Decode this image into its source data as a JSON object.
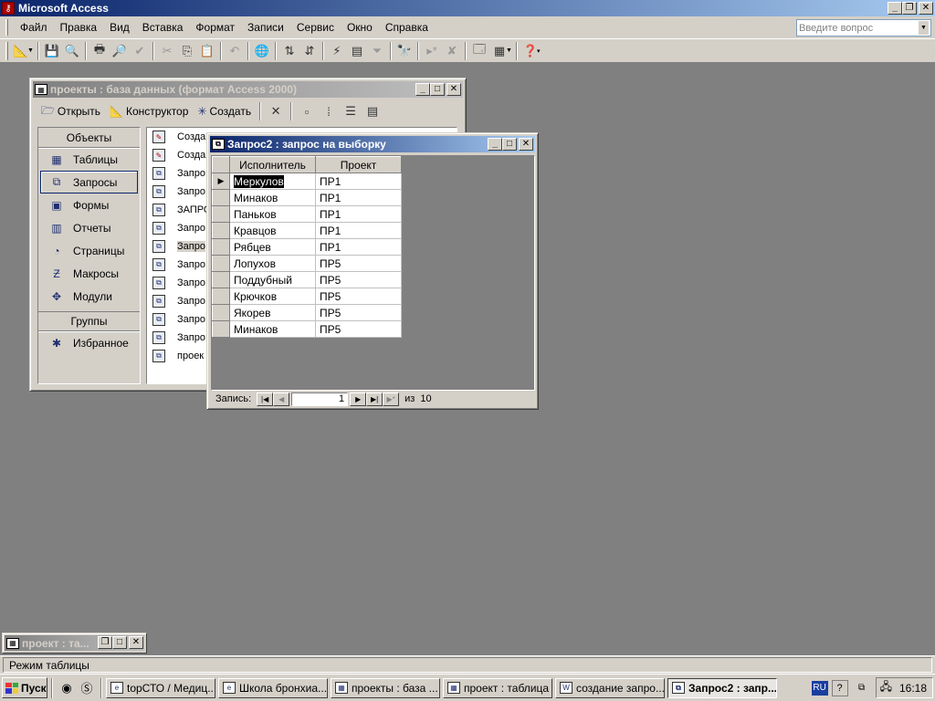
{
  "app": {
    "title": "Microsoft Access"
  },
  "menu": [
    "Файл",
    "Правка",
    "Вид",
    "Вставка",
    "Формат",
    "Записи",
    "Сервис",
    "Окно",
    "Справка"
  ],
  "help_box": {
    "placeholder": "Введите вопрос"
  },
  "db_window": {
    "title": "проекты : база данных (формат Access 2000)",
    "toolbar": {
      "open": "Открыть",
      "design": "Конструктор",
      "create": "Создать"
    },
    "objects_header": "Объекты",
    "objects": [
      {
        "label": "Таблицы",
        "icon": "table-icon"
      },
      {
        "label": "Запросы",
        "icon": "query-icon"
      },
      {
        "label": "Формы",
        "icon": "form-icon"
      },
      {
        "label": "Отчеты",
        "icon": "report-icon"
      },
      {
        "label": "Страницы",
        "icon": "page-icon"
      },
      {
        "label": "Макросы",
        "icon": "macro-icon"
      },
      {
        "label": "Модули",
        "icon": "module-icon"
      }
    ],
    "groups_header": "Группы",
    "groups": [
      {
        "label": "Избранное",
        "icon": "favorites-icon"
      }
    ],
    "items": [
      "Созда",
      "Созда",
      "Запро",
      "Запро",
      "ЗАПРО",
      "Запро",
      "Запро",
      "Запро",
      "Запро",
      "Запро",
      "Запро",
      "Запро",
      "проек"
    ]
  },
  "query_window": {
    "title": "Запрос2 : запрос на выборку",
    "columns": [
      "Исполнитель",
      "Проект"
    ],
    "rows": [
      [
        "Меркулов",
        "ПР1"
      ],
      [
        "Минаков",
        "ПР1"
      ],
      [
        "Паньков",
        "ПР1"
      ],
      [
        "Кравцов",
        "ПР1"
      ],
      [
        "Рябцев",
        "ПР1"
      ],
      [
        "Лопухов",
        "ПР5"
      ],
      [
        "Поддубный",
        "ПР5"
      ],
      [
        "Крючков",
        "ПР5"
      ],
      [
        "Якорев",
        "ПР5"
      ],
      [
        "Минаков",
        "ПР5"
      ]
    ],
    "nav": {
      "label": "Запись:",
      "current": "1",
      "of_label": "из",
      "total": "10"
    }
  },
  "minimized_window": {
    "title": "проект : та..."
  },
  "status": {
    "text": "Режим таблицы"
  },
  "taskbar": {
    "start": "Пуск",
    "tasks": [
      {
        "label": "topСТО / Медиц...",
        "active": false
      },
      {
        "label": "Школа бронхиа...",
        "active": false
      },
      {
        "label": "проекты : база ...",
        "active": false
      },
      {
        "label": "проект : таблица",
        "active": false
      },
      {
        "label": "создание запро...",
        "active": false
      },
      {
        "label": "Запрос2 : запр...",
        "active": true
      }
    ],
    "lang": "RU",
    "time": "16:18"
  }
}
